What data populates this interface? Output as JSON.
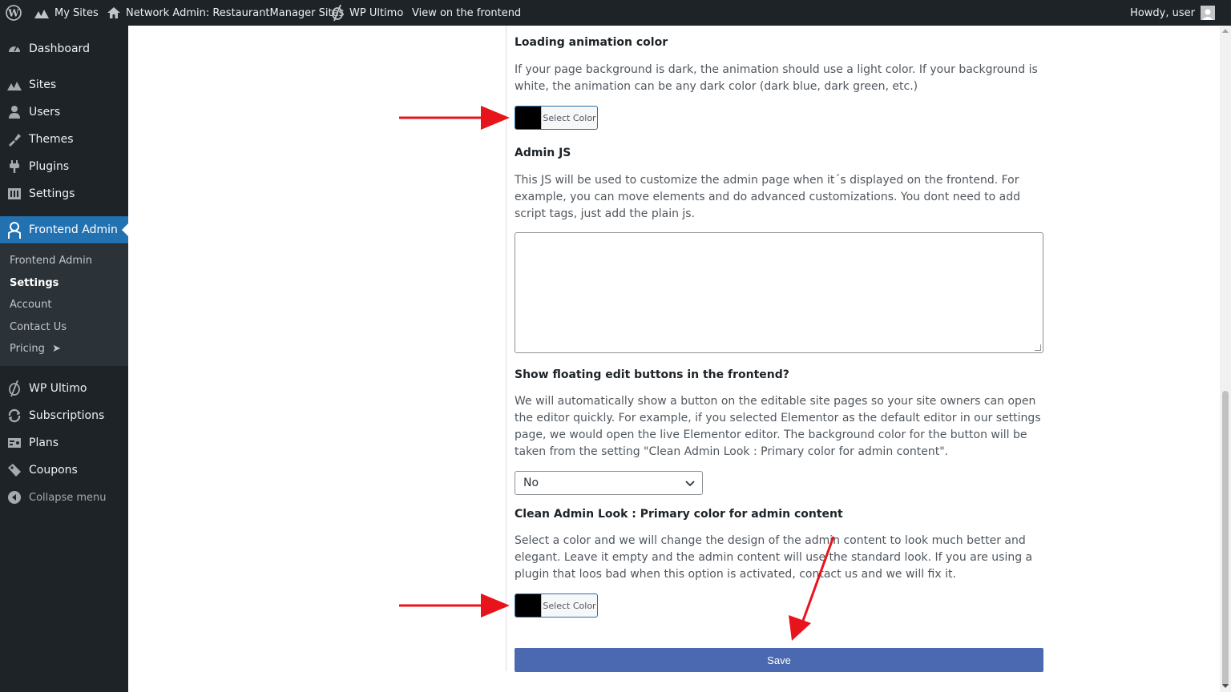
{
  "adminbar": {
    "my_sites": "My Sites",
    "network_admin": "Network Admin: RestaurantManager Sites",
    "wp_ultimo": "WP Ultimo",
    "view_frontend": "View on the frontend",
    "howdy": "Howdy, user"
  },
  "sidebar": {
    "items": [
      {
        "label": "Dashboard",
        "icon": "dashboard-icon"
      },
      {
        "label": "Sites",
        "icon": "sites-icon"
      },
      {
        "label": "Users",
        "icon": "users-icon"
      },
      {
        "label": "Themes",
        "icon": "themes-icon"
      },
      {
        "label": "Plugins",
        "icon": "plugins-icon"
      },
      {
        "label": "Settings",
        "icon": "settings-icon"
      },
      {
        "label": "Frontend Admin",
        "icon": "frontend-admin-icon"
      },
      {
        "label": "WP Ultimo",
        "icon": "wp-ultimo-icon"
      },
      {
        "label": "Subscriptions",
        "icon": "subscriptions-icon"
      },
      {
        "label": "Plans",
        "icon": "plans-icon"
      },
      {
        "label": "Coupons",
        "icon": "coupons-icon"
      }
    ],
    "submenu": [
      "Frontend Admin",
      "Settings",
      "Account",
      "Contact Us",
      "Pricing"
    ],
    "pricing_arrow": "➤",
    "collapse": "Collapse menu"
  },
  "main": {
    "loading_title": "Loading animation color",
    "loading_desc": "If your page background is dark, the animation should use a light color. If your background is white, the animation can be any dark color (dark blue, dark green, etc.)",
    "select_color": "Select Color",
    "swatch_color": "#000000",
    "admin_js_title": "Admin JS",
    "admin_js_desc": "This JS will be used to customize the admin page when it´s displayed on the frontend. For example, you can move elements and do advanced customizations. You dont need to add script tags, just add the plain js.",
    "floating_title": "Show floating edit buttons in the frontend?",
    "floating_desc": "We will automatically show a button on the editable site pages so your site owners can open the editor quickly. For example, if you selected Elementor as the default editor in our settings page, we would open the live Elementor editor. The background color for the button will be taken from the setting \"Clean Admin Look : Primary color for admin content\".",
    "floating_value": "No",
    "clean_title": "Clean Admin Look : Primary color for admin content",
    "clean_desc": "Select a color and we will change the design of the admin content to look much better and elegant. Leave it empty and the admin content will use the standard look. If you are using a plugin that loos bad when this option is activated, contact us and we will fix it.",
    "save_label": "Save"
  },
  "colors": {
    "accent": "#2271b1",
    "save": "#4a69b0",
    "annotation_arrow": "#e8141b"
  }
}
